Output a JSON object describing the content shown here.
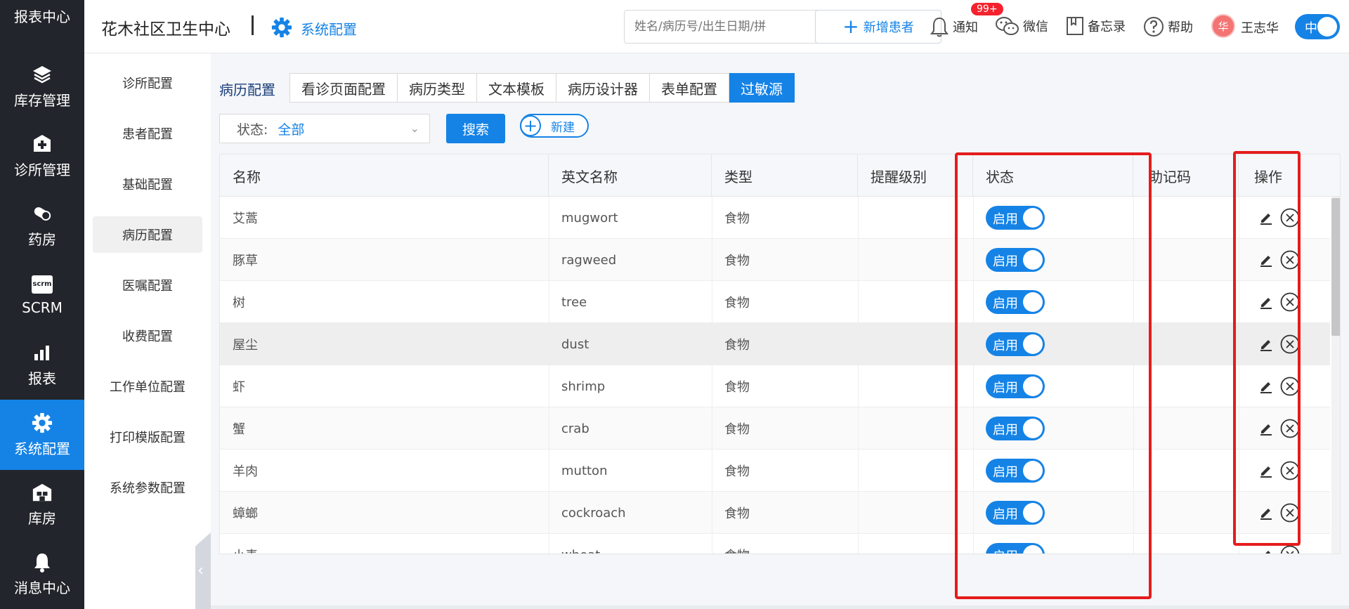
{
  "nav": {
    "items": [
      {
        "label": "报表中心",
        "icon": "report-center-icon"
      },
      {
        "label": "库存管理",
        "icon": "inventory-layers-icon"
      },
      {
        "label": "诊所管理",
        "icon": "clinic-cross-icon"
      },
      {
        "label": "药房",
        "icon": "pill-icon"
      },
      {
        "label": "SCRM",
        "icon": "scrm-icon"
      },
      {
        "label": "报表",
        "icon": "bar-chart-icon"
      },
      {
        "label": "系统配置",
        "icon": "gear-icon"
      },
      {
        "label": "库房",
        "icon": "warehouse-icon"
      },
      {
        "label": "消息中心",
        "icon": "bell-icon"
      }
    ],
    "scrm_icon_text": "scrm",
    "active_color": "#1583e6"
  },
  "header": {
    "clinic_name": "花木社区卫生中心",
    "section_title": "系统配置",
    "search_placeholder": "姓名/病历号/出生日期/拼",
    "new_patient_label": "新增患者",
    "notify_label": "通知",
    "notify_badge": "99+",
    "wechat_label": "微信",
    "memo_label": "备忘录",
    "help_label": "帮助",
    "user_name": "王志华",
    "avatar_text": "华",
    "lang_toggle": "中"
  },
  "subnav": {
    "items": [
      "诊所配置",
      "患者配置",
      "基础配置",
      "病历配置",
      "医嘱配置",
      "收费配置",
      "工作单位配置",
      "打印模版配置",
      "系统参数配置"
    ],
    "active": "病历配置"
  },
  "tabs": {
    "section_label": "病历配置",
    "items": [
      "看诊页面配置",
      "病历类型",
      "文本模板",
      "病历设计器",
      "表单配置",
      "过敏源"
    ],
    "active": "过敏源"
  },
  "filter": {
    "status_label": "状态:",
    "status_value": "全部",
    "search_button": "搜索",
    "new_button": "新建"
  },
  "table": {
    "columns": [
      "名称",
      "英文名称",
      "类型",
      "提醒级别",
      "状态",
      "助记码",
      "操作"
    ],
    "rows": [
      {
        "name": "艾蒿",
        "en": "mugwort",
        "type": "食物",
        "level": "",
        "status": "启用",
        "code": ""
      },
      {
        "name": "豚草",
        "en": "ragweed",
        "type": "食物",
        "level": "",
        "status": "启用",
        "code": ""
      },
      {
        "name": "树",
        "en": "tree",
        "type": "食物",
        "level": "",
        "status": "启用",
        "code": ""
      },
      {
        "name": "屋尘",
        "en": "dust",
        "type": "食物",
        "level": "",
        "status": "启用",
        "code": ""
      },
      {
        "name": "虾",
        "en": "shrimp",
        "type": "食物",
        "level": "",
        "status": "启用",
        "code": ""
      },
      {
        "name": "蟹",
        "en": "crab",
        "type": "食物",
        "level": "",
        "status": "启用",
        "code": ""
      },
      {
        "name": "羊肉",
        "en": "mutton",
        "type": "食物",
        "level": "",
        "status": "启用",
        "code": ""
      },
      {
        "name": "蟑螂",
        "en": "cockroach",
        "type": "食物",
        "level": "",
        "status": "启用",
        "code": ""
      },
      {
        "name": "小麦",
        "en": "wheat",
        "type": "食物",
        "level": "",
        "status": "启用",
        "code": ""
      }
    ]
  },
  "colors": {
    "primary": "#1583e6",
    "highlight_box": "#e51c1c",
    "nav_bg": "#22252b"
  }
}
